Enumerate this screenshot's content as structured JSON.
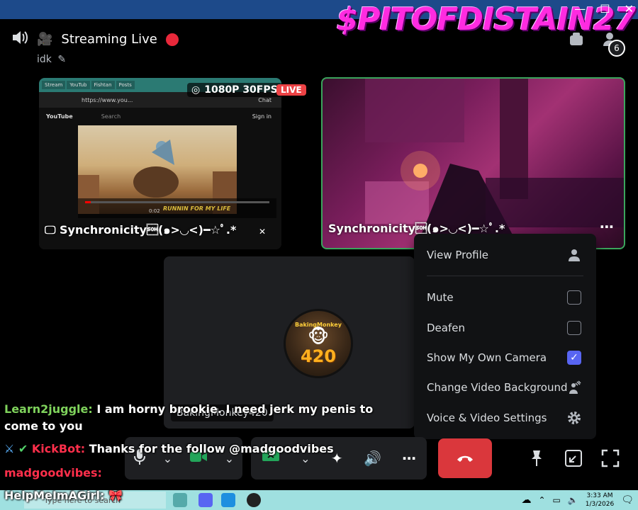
{
  "window": {
    "minimize": "—",
    "maximize": "☐",
    "close": "✕"
  },
  "overlay_name": "$PITOFDISTAIN27",
  "header": {
    "title": "Streaming Live",
    "subtitle": "idk",
    "notification_count": "6"
  },
  "tiles": {
    "stream": {
      "label": "Synchronicity\u0001(๑>◡<)━☆ﾟ.*",
      "resolution": "1080P 30FPS",
      "live_badge": "LIVE",
      "browser": {
        "tabs": [
          "Stream",
          "YouTub",
          "Fishtan",
          "Posts"
        ],
        "url": "https://www.you...",
        "chat_tab": "Chat",
        "yt_logo": "YouTube",
        "yt_search": "Search",
        "yt_signin": "Sign in",
        "video_caption": "RUNNIN FOR MY LIFE",
        "time": "0:02",
        "progress": 0.03
      }
    },
    "camera": {
      "label": "Synchronicity\u0001(๑>◡<)━☆ﾟ.*"
    },
    "avatar": {
      "top_text": "BakingMonkey",
      "number": "420",
      "name_tag": "BakingMonkey420"
    }
  },
  "menu": {
    "items": [
      {
        "label": "View Profile",
        "icon": "user-icon"
      },
      {
        "label": "Mute",
        "checked": false
      },
      {
        "label": "Deafen",
        "checked": false
      },
      {
        "label": "Show My Own Camera",
        "checked": true
      },
      {
        "label": "Change Video Background",
        "icon": "video-background-icon"
      },
      {
        "label": "Voice & Video Settings",
        "icon": "gear-icon"
      }
    ]
  },
  "chat": [
    {
      "user": "Learn2juggle:",
      "text": "I am horny brookie. I need jerk my penis to come to you"
    },
    {
      "user": "KickBot:",
      "text": "Thanks for the follow @madgoodvibes"
    },
    {
      "user": "madgoodvibes:",
      "text": ""
    },
    {
      "user": "HelpMeImAGirl:",
      "text": ""
    }
  ],
  "taskbar": {
    "search_placeholder": "Type here to search",
    "time": "3:33 AM",
    "date": "1/3/2026"
  },
  "colors": {
    "accent": "#5865f2",
    "live": "#ed4245",
    "leave": "#da373c",
    "speaking_border": "#3ba55c"
  }
}
